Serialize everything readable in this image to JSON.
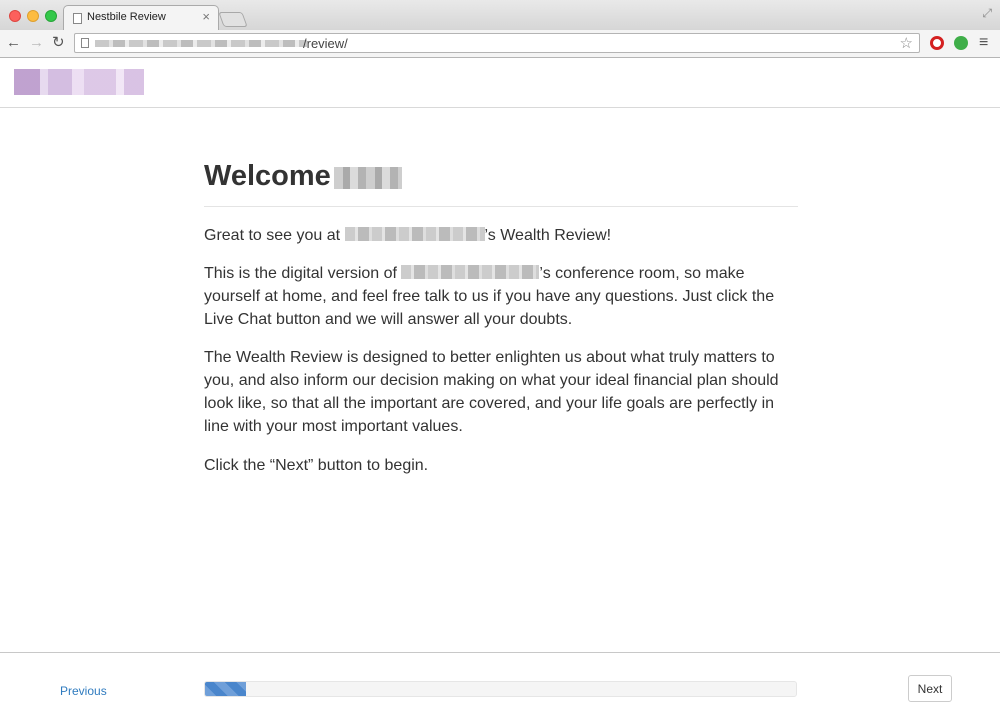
{
  "browser": {
    "tab_title": "Nestbile Review",
    "tab_close": "×",
    "url_visible_path": "/review/",
    "icons": [
      "back-arrow-icon",
      "forward-arrow-icon",
      "reload-icon",
      "page-icon",
      "star-icon",
      "opera-icon",
      "evernote-icon",
      "menu-icon",
      "fullscreen-icon"
    ]
  },
  "header": {
    "logo": "logo (pixelated)"
  },
  "main": {
    "heading": "Welcome",
    "p1_before": "Great to see you at ",
    "p1_after": "’s Wealth Review!",
    "p2_before": "This is the digital version of ",
    "p2_after": "’s conference room, so make yourself at home, and feel free talk to us if you have any questions. Just click the Live Chat button and we will answer all your doubts.",
    "p3": "The Wealth Review is designed to better enlighten us about what truly matters to you, and also inform our decision making on what your ideal financial plan should look like, so that all the important are covered, and your life goals are perfectly in line with your most important values.",
    "p4": "Click the “Next” button to begin."
  },
  "footer": {
    "previous_label": "Previous",
    "next_label": "Next",
    "progress_fraction": 0.07
  },
  "colors": {
    "link": "#2f7bbf",
    "progress": "#4a86cc",
    "logo": "#b592c7"
  }
}
